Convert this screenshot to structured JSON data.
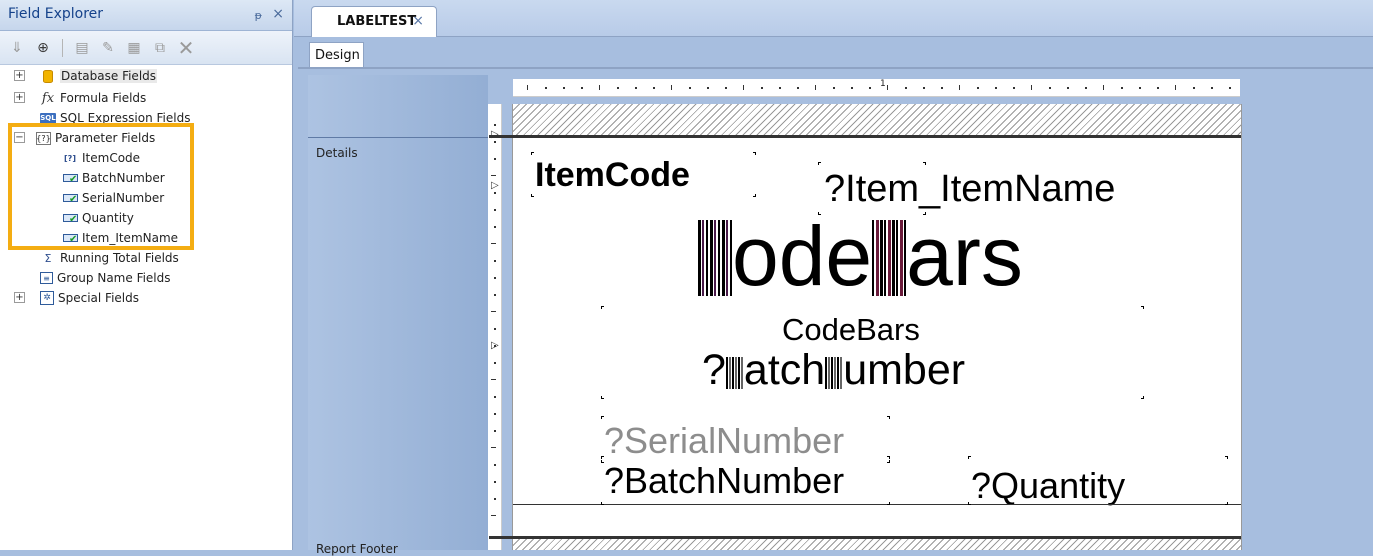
{
  "field_explorer": {
    "title": "Field Explorer",
    "pin": "ᵽ",
    "close": "×",
    "toolbar": [
      {
        "icon": "insert-icon"
      },
      {
        "icon": "browse-icon"
      },
      {
        "icon": "new-icon"
      },
      {
        "icon": "edit-icon"
      },
      {
        "icon": "rename-icon"
      },
      {
        "icon": "copy-icon"
      },
      {
        "icon": "delete-icon"
      }
    ],
    "tree": [
      {
        "label": "Database Fields",
        "icon": "database-icon",
        "expander": "+"
      },
      {
        "label": "Formula Fields",
        "icon": "formula-icon",
        "expander": "+"
      },
      {
        "label": "SQL Expression Fields",
        "icon": "sql-icon",
        "expander": ""
      },
      {
        "label": "Parameter Fields",
        "icon": "parameter-icon",
        "expander": "−"
      },
      {
        "label": "ItemCode",
        "icon": "parameter-item-icon"
      },
      {
        "label": "BatchNumber",
        "icon": "field-check-icon"
      },
      {
        "label": "SerialNumber",
        "icon": "field-check-icon"
      },
      {
        "label": "Quantity",
        "icon": "field-check-icon"
      },
      {
        "label": "Item_ItemName",
        "icon": "field-check-icon"
      },
      {
        "label": "Running Total Fields",
        "icon": "running-total-icon",
        "expander": ""
      },
      {
        "label": "Group Name Fields",
        "icon": "group-name-icon",
        "expander": ""
      },
      {
        "label": "Special Fields",
        "icon": "special-fields-icon",
        "expander": "+"
      }
    ]
  },
  "document_tab": {
    "label": "LABELTEST",
    "close": "×"
  },
  "view_tab": {
    "label": "Design"
  },
  "sections": {
    "details": "Details",
    "footer": "Report Footer"
  },
  "ruler": {
    "mark": "1"
  },
  "report": {
    "item_code": "ItemCode",
    "item_name": "?Item_ItemName",
    "barcode_text": "CodeBars",
    "barcode_chars": [
      "C",
      "ode",
      "B",
      "ars"
    ],
    "barcode_caption": "CodeBars",
    "batch_barcode_chars": [
      "?",
      "B",
      "atch",
      "N",
      "umber"
    ],
    "serial": "?SerialNumber",
    "batch": "?BatchNumber",
    "quantity": "?Quantity"
  }
}
